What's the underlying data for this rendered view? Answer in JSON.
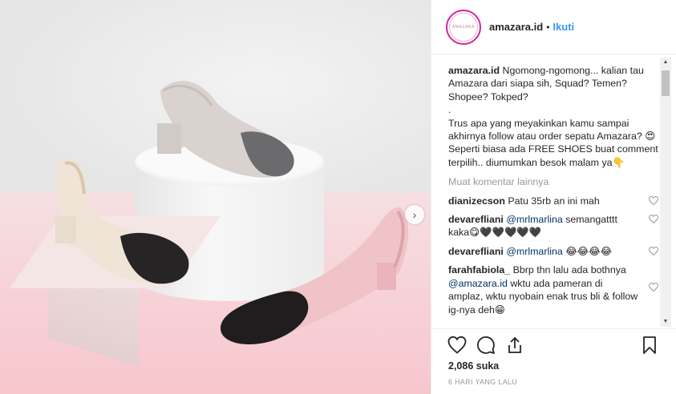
{
  "photo": {
    "next_icon": "chevron-right-icon"
  },
  "header": {
    "avatar_text": "AMAZARA",
    "username": "amazara.id",
    "separator": "•",
    "follow_label": "Ikuti"
  },
  "caption": {
    "username": "amazara.id",
    "lines": [
      "Ngomong-ngomong... kalian tau Amazara dari siapa sih, Squad? Temen? Shopee? Tokped?",
      ".",
      "Trus apa yang meyakinkan kamu sampai akhirnya follow atau order sepatu Amazara? 😍",
      "Seperti biasa ada FREE SHOES buat comment terpilih.. diumumkan besok malam ya👇"
    ]
  },
  "load_more": "Muat komentar lainnya",
  "comments": [
    {
      "user": "dianizecson",
      "text": "Patu 35rb an ini mah",
      "mention": ""
    },
    {
      "user": "devarefliani",
      "mention": "@mrlmarlina",
      "text": "semangatttt kaka😋🖤🖤🖤🖤🖤"
    },
    {
      "user": "devarefliani",
      "mention": "@mrlmarlina",
      "text": "😂😂😂😂"
    },
    {
      "user": "farahfabiola_",
      "mention": "",
      "text": "Bbrp thn lalu ada bothnya ",
      "mention2": "@amazara.id",
      "text2": "wktu ada pameran di amplaz, wktu nyobain enak trus bli & follow ig-nya deh😁"
    }
  ],
  "actions": {
    "like_icon": "heart-icon",
    "comment_icon": "comment-icon",
    "share_icon": "share-icon",
    "save_icon": "bookmark-icon"
  },
  "likes": "2,086 suka",
  "timestamp": "6 HARI YANG LALU"
}
